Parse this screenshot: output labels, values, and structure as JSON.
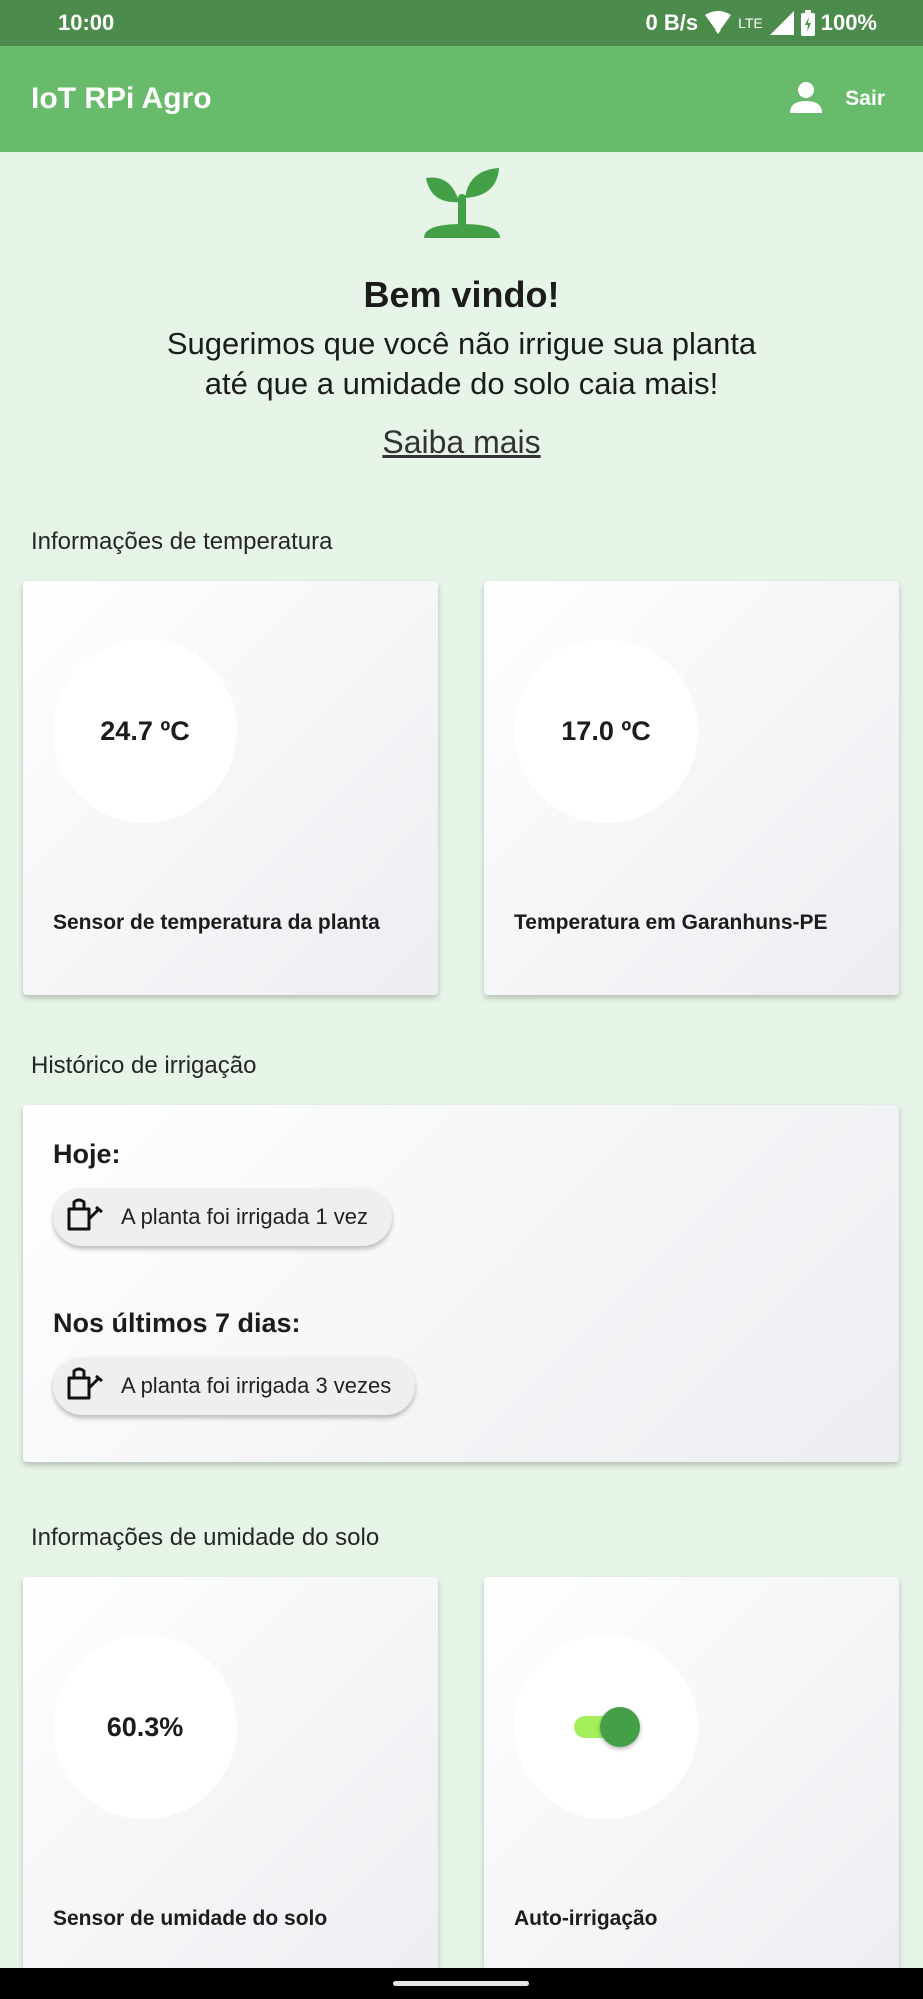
{
  "status_bar": {
    "time": "10:00",
    "net_speed": "0 B/s",
    "network_type": "LTE",
    "battery": "100%",
    "icons": [
      "wifi-icon",
      "lte-icon",
      "signal-icon",
      "battery-charging-icon"
    ]
  },
  "app_bar": {
    "title": "IoT RPi Agro",
    "user_icon": "person-icon",
    "logout_label": "Sair"
  },
  "welcome": {
    "icon": "sprout-icon",
    "title": "Bem vindo!",
    "message_line1": "Sugerimos que você não irrigue sua planta",
    "message_line2": "até que a umidade do solo caia mais!",
    "learn_more": "Saiba mais"
  },
  "temperature": {
    "section_title": "Informações de temperatura",
    "plant_sensor": {
      "value": "24.7 ºC",
      "label": "Sensor de temperatura da planta"
    },
    "city": {
      "value": "17.0 ºC",
      "label": "Temperatura em Garanhuns-PE"
    }
  },
  "irrigation_history": {
    "section_title": "Histórico de irrigação",
    "today_heading": "Hoje:",
    "today_text": "A planta foi irrigada 1 vez",
    "week_heading": "Nos últimos 7 dias:",
    "week_text": "A planta foi irrigada 3 vezes",
    "chip_icon": "watering-can-icon"
  },
  "soil": {
    "section_title": "Informações de umidade do solo",
    "moisture": {
      "value": "60.3%",
      "label": "Sensor de umidade do solo"
    },
    "auto_irrigation": {
      "label": "Auto-irrigação",
      "enabled": true
    }
  },
  "colors": {
    "status_bar": "#4b8b4c",
    "app_bar": "#67bb6b",
    "background": "#e7f4e8",
    "accent": "#43a047",
    "toggle_track": "#a4ef5c"
  }
}
